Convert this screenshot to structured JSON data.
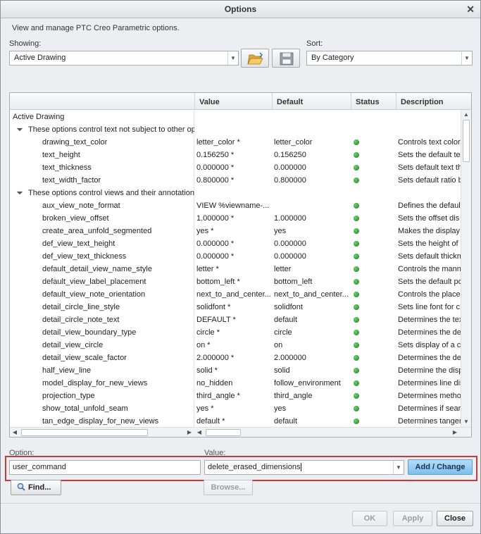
{
  "window": {
    "title": "Options",
    "close_glyph": "✕"
  },
  "description": "View and manage PTC Creo Parametric options.",
  "showing": {
    "label": "Showing:",
    "value": "Active Drawing"
  },
  "sort": {
    "label": "Sort:",
    "value": "By Category"
  },
  "toolbar": {
    "open_icon": "folder-open-icon",
    "save_icon": "save-icon"
  },
  "table": {
    "columns": [
      "Value",
      "Default",
      "Status",
      "Description"
    ],
    "rows": [
      {
        "type": "root",
        "name": "Active Drawing"
      },
      {
        "type": "group",
        "name": "These options control text not subject to other op"
      },
      {
        "type": "option",
        "name": "drawing_text_color",
        "value": "letter_color *",
        "default": "letter_color",
        "desc": "Controls text color"
      },
      {
        "type": "option",
        "name": "text_height",
        "value": "0.156250 *",
        "default": "0.156250",
        "desc": "Sets the default te"
      },
      {
        "type": "option",
        "name": "text_thickness",
        "value": "0.000000 *",
        "default": "0.000000",
        "desc": "Sets default text th"
      },
      {
        "type": "option",
        "name": "text_width_factor",
        "value": "0.800000 *",
        "default": "0.800000",
        "desc": "Sets default ratio b"
      },
      {
        "type": "group",
        "name": "These options control views and their annotation"
      },
      {
        "type": "option",
        "name": "aux_view_note_format",
        "value": "VIEW %viewname-...",
        "default": "",
        "desc": "Defines the defaul"
      },
      {
        "type": "option",
        "name": "broken_view_offset",
        "value": "1.000000 *",
        "default": "1.000000",
        "desc": "Sets the offset dis"
      },
      {
        "type": "option",
        "name": "create_area_unfold_segmented",
        "value": "yes *",
        "default": "yes",
        "desc": "Makes the display"
      },
      {
        "type": "option",
        "name": "def_view_text_height",
        "value": "0.000000 *",
        "default": "0.000000",
        "desc": "Sets the height of"
      },
      {
        "type": "option",
        "name": "def_view_text_thickness",
        "value": "0.000000 *",
        "default": "0.000000",
        "desc": "Sets default thickn"
      },
      {
        "type": "option",
        "name": "default_detail_view_name_style",
        "value": "letter *",
        "default": "letter",
        "desc": "Controls the manne"
      },
      {
        "type": "option",
        "name": "default_view_label_placement",
        "value": "bottom_left *",
        "default": "bottom_left",
        "desc": "Sets the default po"
      },
      {
        "type": "option",
        "name": "default_view_note_orientation",
        "value": "next_to_and_center...",
        "default": "next_to_and_center...",
        "desc": "Controls the place"
      },
      {
        "type": "option",
        "name": "detail_circle_line_style",
        "value": "solidfont *",
        "default": "solidfont",
        "desc": "Sets line font for c"
      },
      {
        "type": "option",
        "name": "detail_circle_note_text",
        "value": "DEFAULT *",
        "default": "default",
        "desc": "Determines the tex"
      },
      {
        "type": "option",
        "name": "detail_view_boundary_type",
        "value": "circle *",
        "default": "circle",
        "desc": "Determines the de"
      },
      {
        "type": "option",
        "name": "detail_view_circle",
        "value": "on *",
        "default": "on",
        "desc": "Sets display of a c"
      },
      {
        "type": "option",
        "name": "detail_view_scale_factor",
        "value": "2.000000 *",
        "default": "2.000000",
        "desc": "Determines the de"
      },
      {
        "type": "option",
        "name": "half_view_line",
        "value": "solid *",
        "default": "solid",
        "desc": "Determine the disp"
      },
      {
        "type": "option",
        "name": "model_display_for_new_views",
        "value": "no_hidden",
        "default": "follow_environment",
        "desc": "Determines line dis"
      },
      {
        "type": "option",
        "name": "projection_type",
        "value": "third_angle *",
        "default": "third_angle",
        "desc": "Determines metho"
      },
      {
        "type": "option",
        "name": "show_total_unfold_seam",
        "value": "yes *",
        "default": "yes",
        "desc": "Determines if sear"
      },
      {
        "type": "option",
        "name": "tan_edge_display_for_new_views",
        "value": "default *",
        "default": "default",
        "desc": "Determines tanger"
      }
    ]
  },
  "editor": {
    "option_label": "Option:",
    "option_value": "user_command",
    "value_label": "Value:",
    "value_value": "delete_erased_dimensions",
    "add_change_label": "Add / Change",
    "find_label": "Find...",
    "browse_label": "Browse..."
  },
  "footer": {
    "ok_label": "OK",
    "apply_label": "Apply",
    "close_label": "Close"
  },
  "colors": {
    "status_ok": "#2a9a2a",
    "highlight": "#c43b3b",
    "accent": "#7ebfee"
  }
}
